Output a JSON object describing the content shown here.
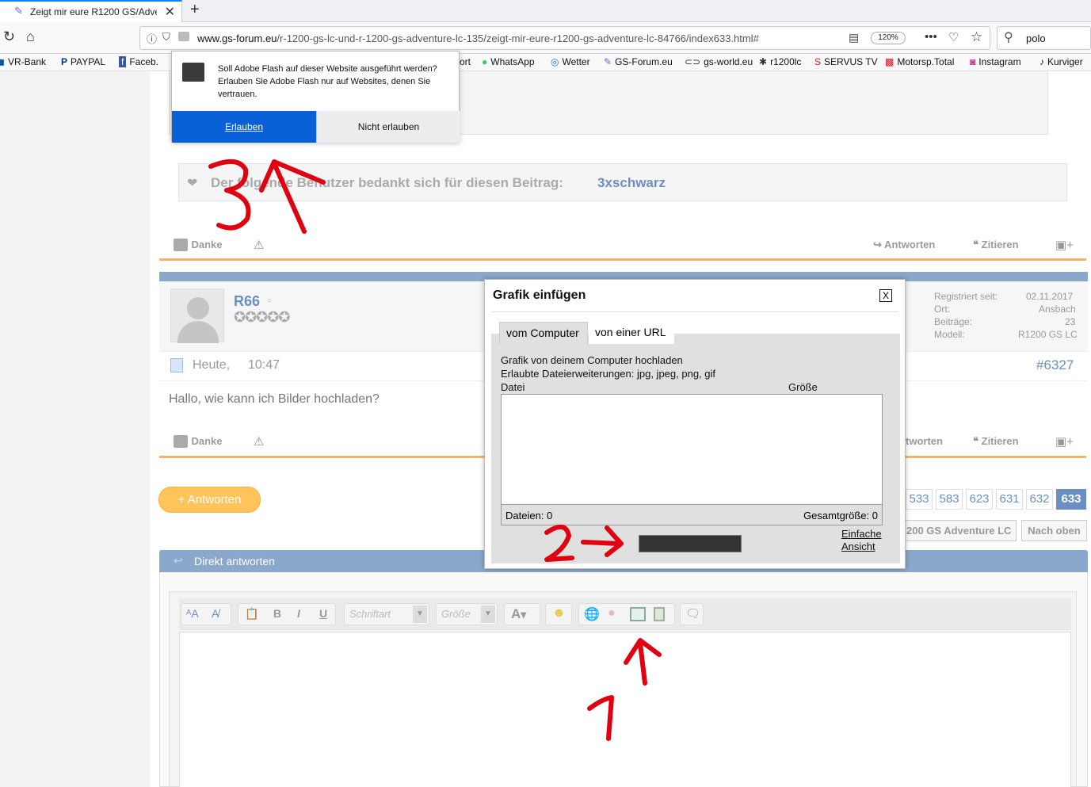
{
  "browser": {
    "tab_title": "Zeigt mir eure R1200 GS/Adven",
    "url_domain": "www.gs-forum.eu",
    "url_path": "/r-1200-gs-lc-und-r-1200-gs-adventure-lc-135/zeigt-mir-eure-r1200-gs-adventure-lc-84766/index633.html#",
    "zoom": "120%",
    "search_value": "polo",
    "bookmarks": [
      "VR-Bank",
      "PAYPAL",
      "Faceb.",
      "ort",
      "WhatsApp",
      "Wetter",
      "GS-Forum.eu",
      "gs-world.eu",
      "r1200lc",
      "SERVUS TV",
      "Motorsp.Total",
      "Instagram",
      "Kurviger"
    ]
  },
  "flash_prompt": {
    "text": "Soll Adobe Flash auf dieser Website ausgeführt werden? Erlauben Sie Adobe Flash nur auf Websites, denen Sie vertrauen.",
    "allow": "Erlauben",
    "deny": "Nicht erlauben"
  },
  "post1": {
    "thanks_text": "Der folgende Benutzer bedankt sich für diesen Beitrag:",
    "thanks_user": "3xschwarz",
    "danke": "Danke",
    "antworten": "Antworten",
    "zitieren": "Zitieren"
  },
  "post2": {
    "username": "R66",
    "registered_label": "Registriert seit:",
    "registered_value": "02.11.2017",
    "ort_label": "Ort:",
    "ort_value": "Ansbach",
    "beitraege_label": "Beiträge:",
    "beitraege_value": "23",
    "modell_label": "Modell:",
    "modell_value": "R1200 GS LC",
    "date": "Heute,",
    "time": "10:47",
    "post_number": "#6327",
    "message": "Hallo, wie kann ich Bilder hochladen?",
    "danke": "Danke",
    "antworten": "tworten",
    "zitieren": "Zitieren"
  },
  "reply_button": "+ Antworten",
  "pagination": [
    "533",
    "583",
    "623",
    "631",
    "632",
    "633"
  ],
  "nav_buttons": [
    "200 GS Adventure LC",
    "Nach oben"
  ],
  "direct_reply": "Direkt antworten",
  "editor": {
    "font_placeholder": "Schriftart",
    "size_placeholder": "Größe"
  },
  "dialog": {
    "title": "Grafik einfügen",
    "close": "X",
    "tab_computer": "vom Computer",
    "tab_url": "von einer URL",
    "upload_text": "Grafik von deinem Computer hochladen",
    "extensions": "Erlaubte Dateierweiterungen: jpg, jpeg, png, gif",
    "col_file": "Datei",
    "col_size": "Größe",
    "files_count": "Dateien: 0",
    "total_size": "Gesamtgröße: 0",
    "simple_view_1": "Einfache",
    "simple_view_2": "Ansicht"
  },
  "annotations": {
    "colors": {
      "marker": "#e0000f"
    }
  }
}
